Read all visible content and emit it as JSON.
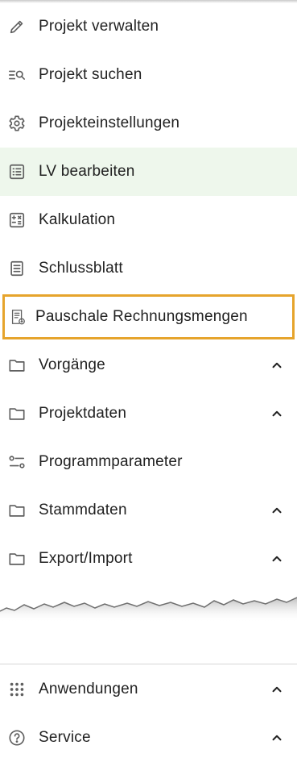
{
  "menu": {
    "items": [
      {
        "label": "Projekt verwalten",
        "icon": "pencil-icon"
      },
      {
        "label": "Projekt suchen",
        "icon": "search-list-icon"
      },
      {
        "label": "Projekteinstellungen",
        "icon": "gear-icon"
      },
      {
        "label": "LV bearbeiten",
        "icon": "list-icon",
        "active": true
      },
      {
        "label": "Kalkulation",
        "icon": "calculator-icon"
      },
      {
        "label": "Schlussblatt",
        "icon": "document-icon"
      },
      {
        "label": "Pauschale Rechnungsmengen",
        "icon": "invoice-icon",
        "highlighted": true
      },
      {
        "label": "Vorgänge",
        "icon": "folder-icon",
        "expandable": true
      },
      {
        "label": "Projektdaten",
        "icon": "folder-icon",
        "expandable": true
      },
      {
        "label": "Programmparameter",
        "icon": "parameters-icon"
      },
      {
        "label": "Stammdaten",
        "icon": "folder-icon",
        "expandable": true
      },
      {
        "label": "Export/Import",
        "icon": "folder-icon",
        "expandable": true
      }
    ]
  },
  "footer": {
    "items": [
      {
        "label": "Anwendungen",
        "icon": "apps-grid-icon",
        "expandable": true
      },
      {
        "label": "Service",
        "icon": "help-circle-icon",
        "expandable": true
      }
    ]
  },
  "colors": {
    "active_background": "#eef7ec",
    "highlight_border": "#e6a42c",
    "icon": "#5f5f5f",
    "text": "#212121"
  }
}
